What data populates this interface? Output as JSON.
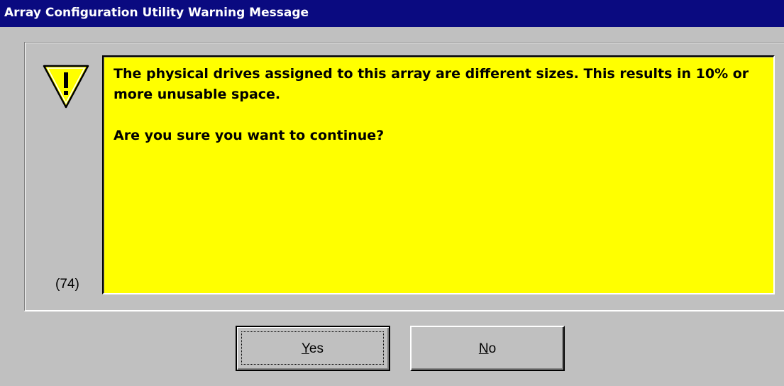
{
  "window": {
    "title": "Array Configuration Utility Warning Message"
  },
  "dialog": {
    "icon": "warning-triangle-icon",
    "message_code": "(74)",
    "message_line1": "The physical drives assigned to this array are different sizes. This results in 10% or more unusable space.",
    "message_line2": "Are you sure you want to continue?",
    "message_background": "#ffff00"
  },
  "buttons": {
    "yes": {
      "accel": "Y",
      "rest": "es"
    },
    "no": {
      "accel": "N",
      "rest": "o"
    }
  },
  "colors": {
    "title_bar": "#0a0a80",
    "face": "#c0c0c0",
    "icon_fill": "#ffff00"
  }
}
